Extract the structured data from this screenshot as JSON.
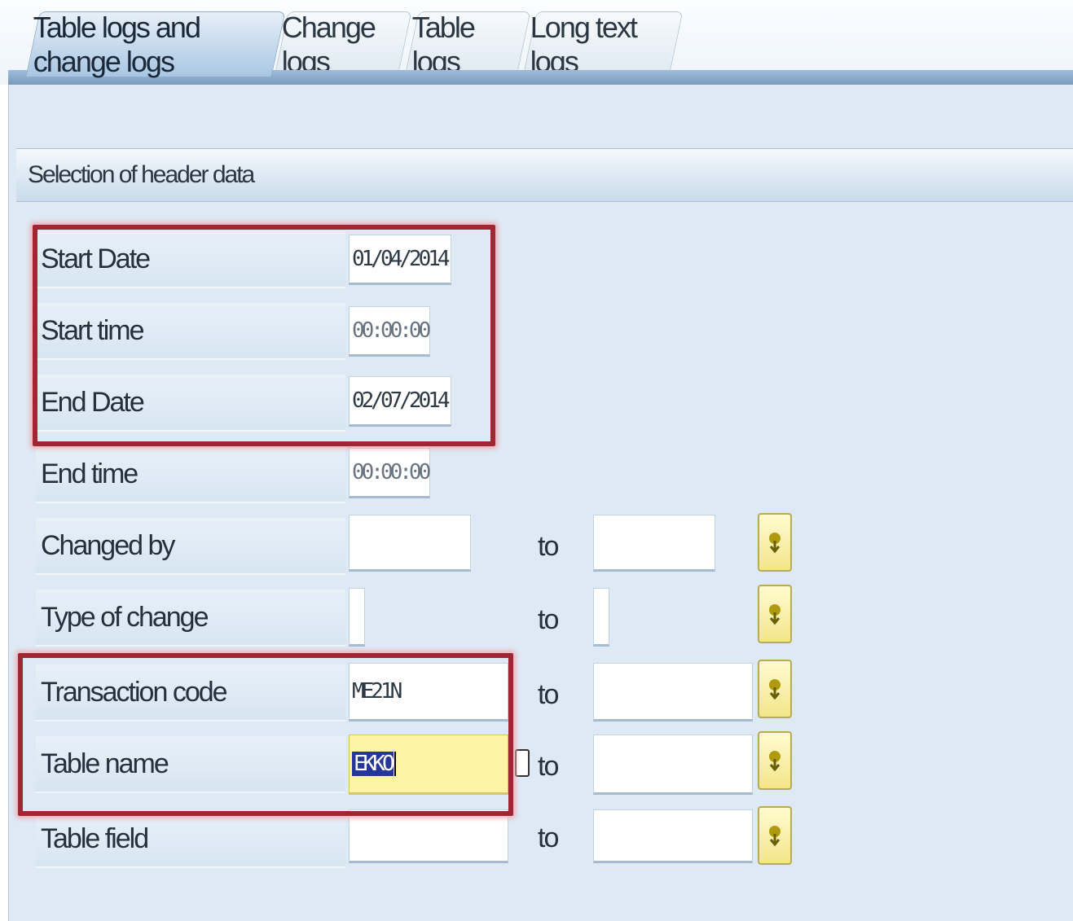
{
  "tabs": [
    {
      "label": "Table logs and change logs",
      "active": true
    },
    {
      "label": "Change logs",
      "active": false
    },
    {
      "label": "Table logs",
      "active": false
    },
    {
      "label": "Long text logs",
      "active": false
    }
  ],
  "group": {
    "title": "Selection of header data"
  },
  "rows": {
    "start_date": {
      "label": "Start Date",
      "value": "01/04/2014"
    },
    "start_time": {
      "label": "Start time",
      "value": "00:00:00"
    },
    "end_date": {
      "label": "End Date",
      "value": "02/07/2014"
    },
    "end_time": {
      "label": "End time",
      "value": "00:00:00"
    },
    "changed_by": {
      "label": "Changed by",
      "from": "",
      "to_label": "to",
      "to": ""
    },
    "type_of_change": {
      "label": "Type of change",
      "from": "",
      "to_label": "to",
      "to": ""
    },
    "transaction_code": {
      "label": "Transaction code",
      "from": "ME21N",
      "to_label": "to",
      "to": ""
    },
    "table_name": {
      "label": "Table name",
      "from": "EKKO",
      "to_label": "to",
      "to": ""
    },
    "table_field": {
      "label": "Table field",
      "from": "",
      "to_label": "to",
      "to": ""
    }
  },
  "icons": {
    "multiple_selection": "multiple-selection-arrow-icon"
  },
  "colors": {
    "highlight": "#a02634",
    "focus_field": "#fff3a6",
    "selection_button": "#f3e58a"
  }
}
